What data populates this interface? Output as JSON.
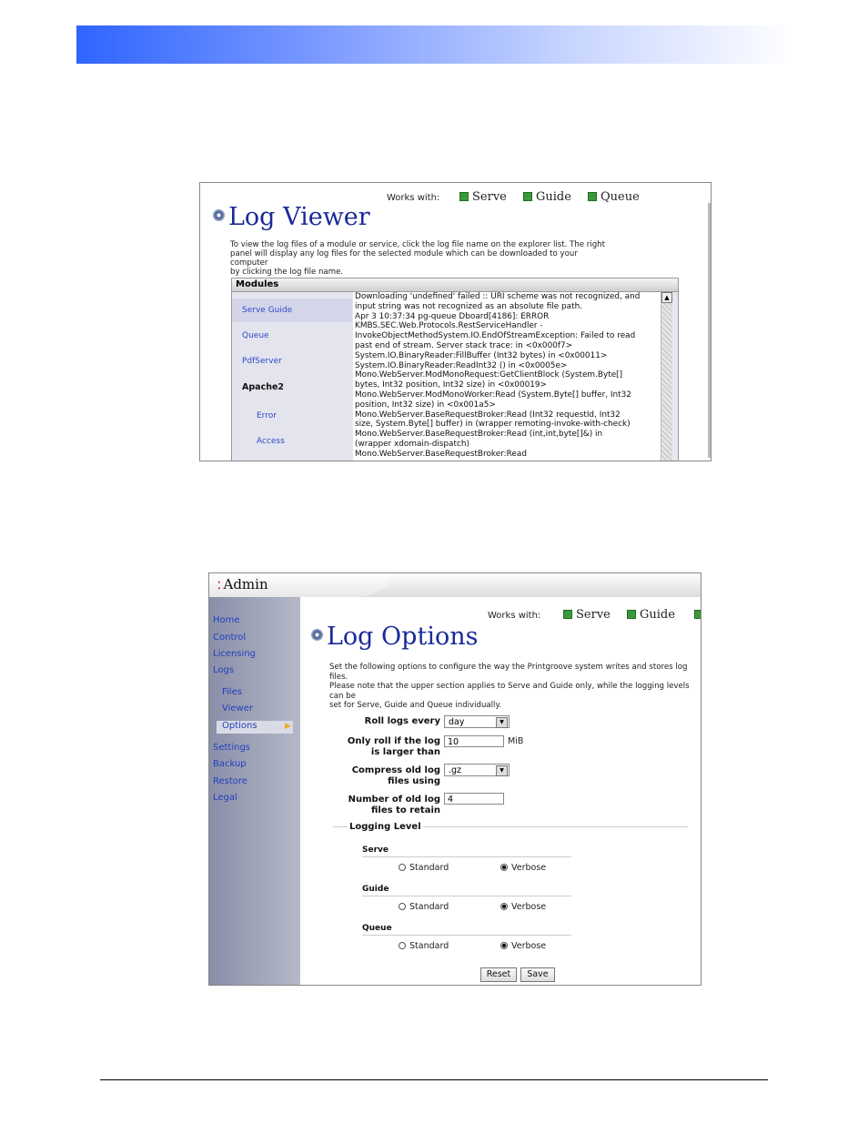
{
  "log_viewer": {
    "works_with_label": "Works with:",
    "works_with": [
      "Serve",
      "Guide",
      "Queue"
    ],
    "title": "Log Viewer",
    "description": [
      "To view the log files of a module or service, click the log file name on the explorer list. The right",
      "panel will display any log files for the selected module which can be downloaded to your computer",
      "by clicking the log file name."
    ],
    "modules_header": "Modules",
    "modules": [
      "Serve Guide",
      "Queue",
      "PdfServer",
      "Apache2",
      "Error",
      "Access"
    ],
    "log_lines": [
      "Downloading 'undefined' failed :: URI scheme was not recognized, and",
      "input string was not recognized as an absolute file path.",
      "Apr  3 10:37:34 pg-queue Dboard[4186]: ERROR",
      "KMBS.SEC.Web.Protocols.RestServiceHandler -",
      "InvokeObjectMethodSystem.IO.EndOfStreamException: Failed to read",
      "past end of stream.  Server stack trace:  in <0x000f7>",
      "System.IO.BinaryReader:FillBuffer (Int32 bytes) in <0x00011>",
      "System.IO.BinaryReader:ReadInt32 () in <0x0005e>",
      "Mono.WebServer.ModMonoRequest:GetClientBlock (System.Byte[]",
      "bytes, Int32 position, Int32 size) in <0x00019>",
      "Mono.WebServer.ModMonoWorker:Read (System.Byte[] buffer, Int32",
      "position, Int32 size) in <0x001a5>",
      "Mono.WebServer.BaseRequestBroker:Read (Int32 requestId, Int32",
      "size, System.Byte[] buffer) in (wrapper remoting-invoke-with-check)",
      "Mono.WebServer.BaseRequestBroker:Read (int,int,byte[]&) in",
      "(wrapper xdomain-dispatch)",
      "Mono.WebServer.BaseRequestBroker:Read"
    ]
  },
  "log_options": {
    "app_title": "Admin",
    "nav": [
      "Home",
      "Control",
      "Licensing",
      "Logs",
      "Files",
      "Viewer",
      "Options",
      "Settings",
      "Backup",
      "Restore",
      "Legal"
    ],
    "works_with_label": "Works with:",
    "works_with": [
      "Serve",
      "Guide"
    ],
    "title": "Log Options",
    "description": [
      "Set the following options to configure the way the Printgroove system writes and stores log files.",
      "Please note that the upper section applies to Serve and Guide only, while the logging levels can be",
      "set for Serve, Guide and Queue individually."
    ],
    "fields": {
      "roll_label": "Roll logs every",
      "roll_value": "day",
      "only_roll_label_1": "Only roll if the log",
      "only_roll_label_2": "is larger than",
      "only_roll_value": "10",
      "only_roll_unit": "MiB",
      "compress_label_1": "Compress old log",
      "compress_label_2": "files using",
      "compress_value": ".gz",
      "retain_label_1": "Number of old log",
      "retain_label_2": "files to retain",
      "retain_value": "4"
    },
    "logging_level_label": "Logging Level",
    "levels": [
      {
        "name": "Serve",
        "standard": "Standard",
        "verbose": "Verbose"
      },
      {
        "name": "Guide",
        "standard": "Standard",
        "verbose": "Verbose"
      },
      {
        "name": "Queue",
        "standard": "Standard",
        "verbose": "Verbose"
      }
    ],
    "reset_label": "Reset",
    "save_label": "Save"
  }
}
